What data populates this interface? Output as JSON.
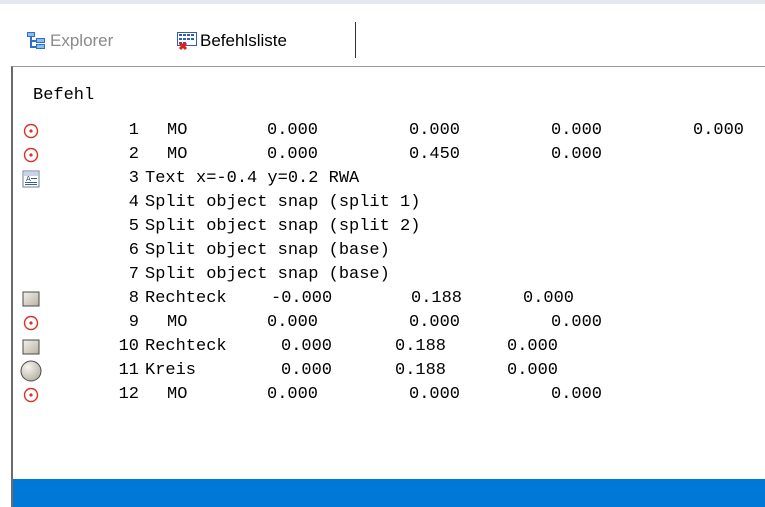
{
  "tabs": [
    {
      "label": "Explorer",
      "icon": "explorer-tree-icon",
      "active": false
    },
    {
      "label": "Befehlsliste",
      "icon": "command-list-icon",
      "active": true
    }
  ],
  "list": {
    "column_header": "Befehl",
    "rows": [
      {
        "num": "1",
        "icon": "target-icon",
        "cmd": "MO",
        "values": [
          "0.000",
          "0.000",
          "0.000",
          "0.000"
        ]
      },
      {
        "num": "2",
        "icon": "target-icon",
        "cmd": "MO",
        "values": [
          "0.000",
          "0.450",
          "0.000"
        ]
      },
      {
        "num": "3",
        "icon": "text-icon",
        "cmd": "Text x=-0.4 y=0.2 RWA",
        "values": []
      },
      {
        "num": "4",
        "icon": "",
        "cmd": "Split object snap (split 1)",
        "values": []
      },
      {
        "num": "5",
        "icon": "",
        "cmd": "Split object snap (split 2)",
        "values": []
      },
      {
        "num": "6",
        "icon": "",
        "cmd": "Split object snap (base)",
        "values": []
      },
      {
        "num": "7",
        "icon": "",
        "cmd": "Split object snap (base)",
        "values": []
      },
      {
        "num": "8",
        "icon": "rectangle-icon",
        "cmd": "Rechteck",
        "values": [
          "-0.000",
          "0.188",
          "0.000"
        ]
      },
      {
        "num": "9",
        "icon": "target-icon",
        "cmd": "MO",
        "values": [
          "0.000",
          "0.000",
          "0.000"
        ]
      },
      {
        "num": "10",
        "icon": "rectangle-icon",
        "cmd": "Rechteck",
        "values": [
          "0.000",
          "0.188",
          "0.000"
        ]
      },
      {
        "num": "11",
        "icon": "circle-icon",
        "cmd": "Kreis",
        "values": [
          "0.000",
          "0.188",
          "0.000"
        ]
      },
      {
        "num": "12",
        "icon": "target-icon",
        "cmd": "MO",
        "values": [
          "0.000",
          "0.000",
          "0.000"
        ]
      }
    ]
  },
  "colors": {
    "selection": "#0078d7",
    "target_red": "#d9322b"
  }
}
